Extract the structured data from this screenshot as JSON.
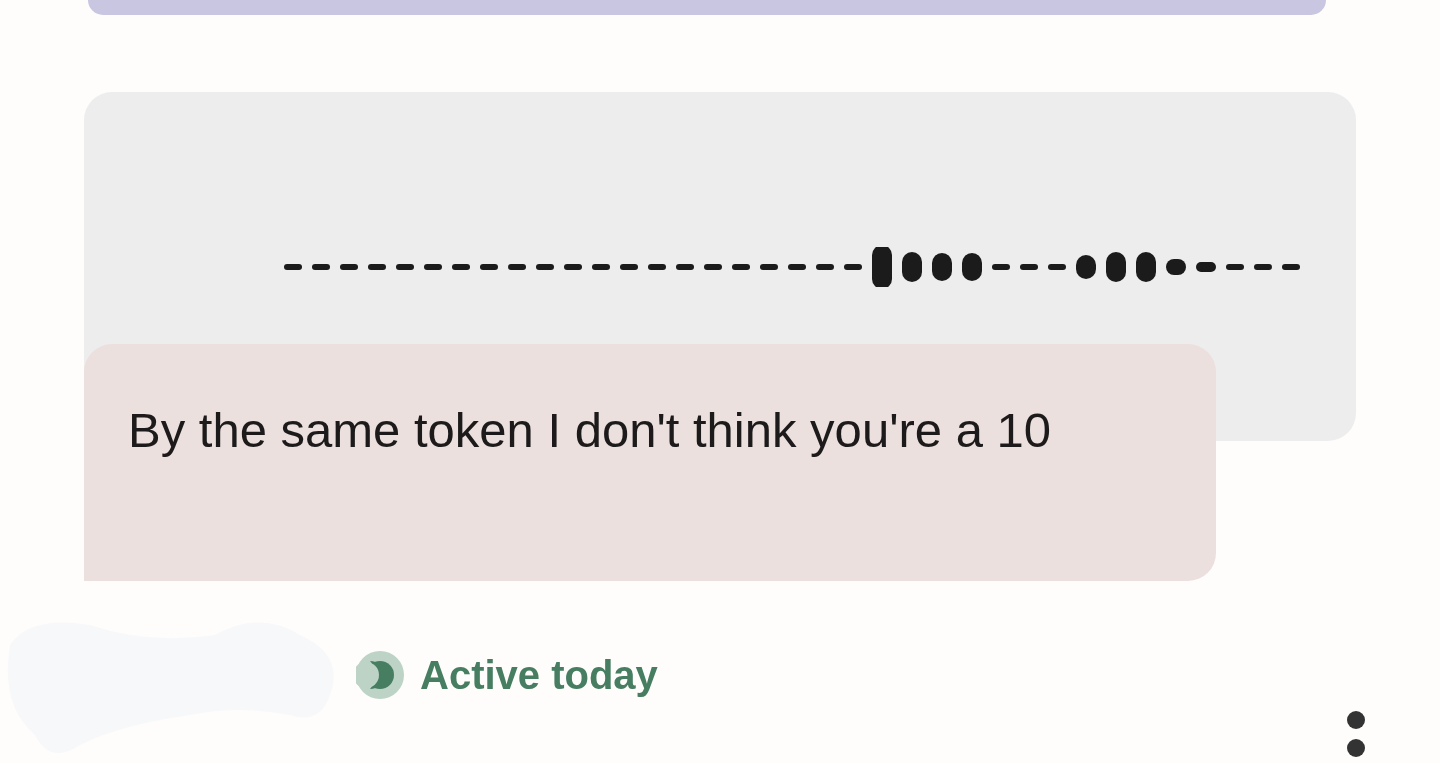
{
  "message": {
    "text": "By the same token I don't think you're a 10"
  },
  "status": {
    "text": "Active today"
  }
}
